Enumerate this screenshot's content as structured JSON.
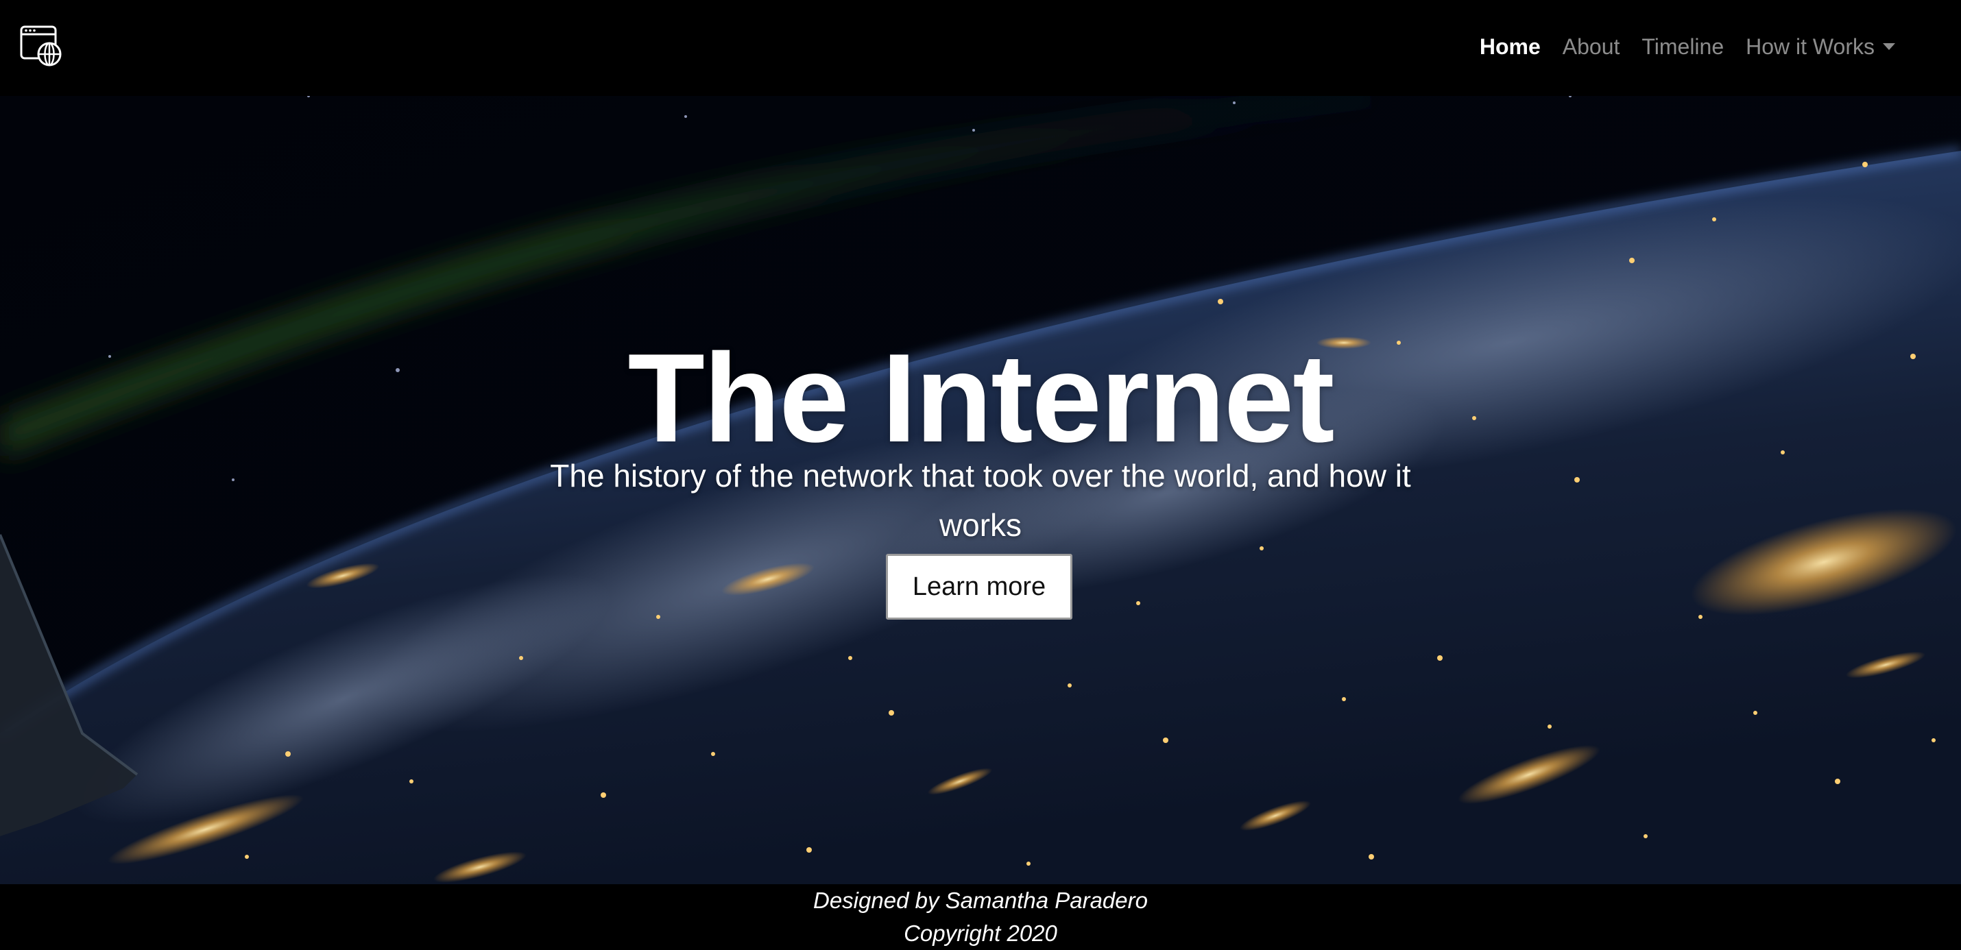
{
  "nav": {
    "brand_icon": "globe-window-icon",
    "items": [
      {
        "label": "Home",
        "active": true
      },
      {
        "label": "About",
        "active": false
      },
      {
        "label": "Timeline",
        "active": false
      },
      {
        "label": "How it Works",
        "active": false,
        "dropdown": true
      }
    ]
  },
  "hero": {
    "title": "The Internet",
    "subtitle": "The history of the network that took over the world, and how it works",
    "cta_label": "Learn more",
    "background": "earth-at-night-from-orbit"
  },
  "footer": {
    "line1": "Designed by Samantha Paradero",
    "line2": "Copyright 2020"
  },
  "colors": {
    "background": "#000000",
    "nav_active": "#ffffff",
    "nav_inactive": "#8c8c8c",
    "city_lights": "#ffc766"
  }
}
